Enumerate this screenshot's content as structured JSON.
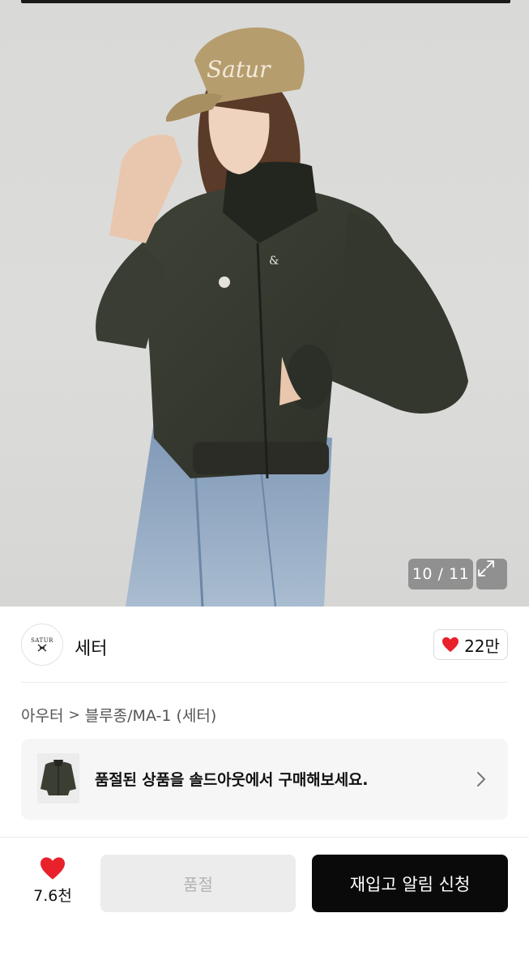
{
  "gallery": {
    "counter": "10 / 11",
    "expand_icon": "expand-icon",
    "cap_logo_text": "Satur"
  },
  "brand": {
    "logo_text": "SATUR",
    "name": "세터",
    "likes": "22만"
  },
  "breadcrumb": {
    "category": "아우터",
    "separator": ">",
    "subcategory": "블루종/MA-1 (세터)"
  },
  "soldout_banner": {
    "text": "품절된 상품을 솔드아웃에서 구매해보세요."
  },
  "bottom_bar": {
    "wish_count": "7.6천",
    "soldout_label": "품절",
    "restock_label": "재입고 알림 신청"
  },
  "colors": {
    "heart": "#e8212b",
    "primary_button": "#0a0a0a",
    "disabled_button": "#ececec"
  }
}
